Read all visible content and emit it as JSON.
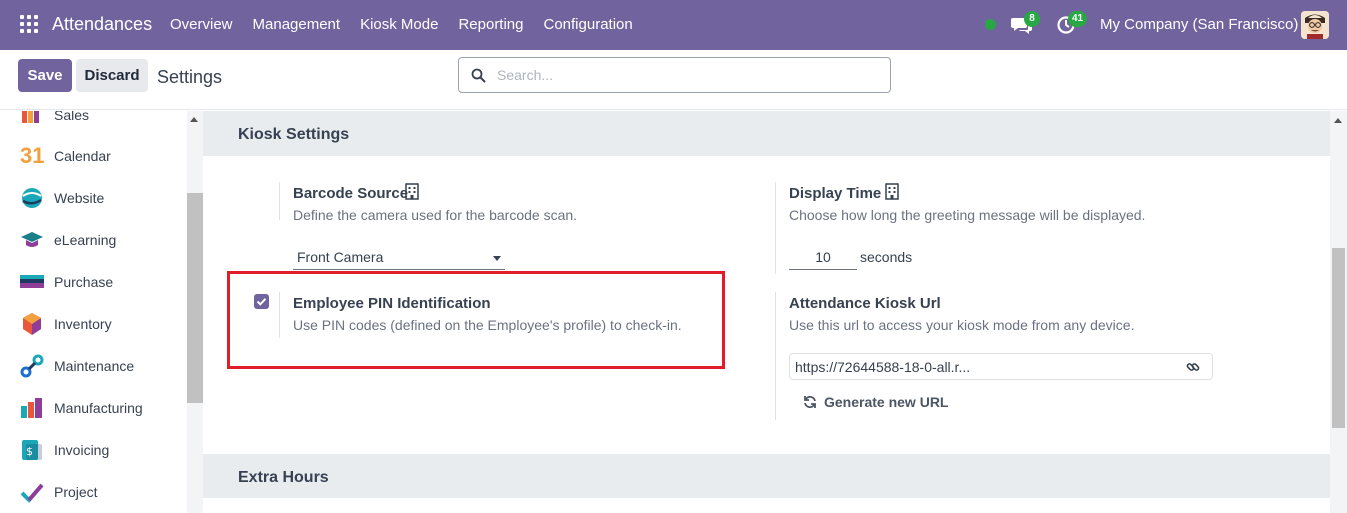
{
  "navbar": {
    "app_title": "Attendances",
    "menu": [
      "Overview",
      "Management",
      "Kiosk Mode",
      "Reporting",
      "Configuration"
    ],
    "chat_badge": "8",
    "activity_badge": "41",
    "company": "My Company (San Francisco)",
    "presence_color": "#28a745",
    "brand_color": "#71639e"
  },
  "control": {
    "save_label": "Save",
    "discard_label": "Discard",
    "title": "Settings",
    "search_placeholder": "Search..."
  },
  "sidebar": {
    "items": [
      {
        "label": "Sales",
        "icon": "sales-icon"
      },
      {
        "label": "Calendar",
        "icon": "calendar-icon"
      },
      {
        "label": "Website",
        "icon": "website-icon"
      },
      {
        "label": "eLearning",
        "icon": "elearning-icon"
      },
      {
        "label": "Purchase",
        "icon": "purchase-icon"
      },
      {
        "label": "Inventory",
        "icon": "inventory-icon"
      },
      {
        "label": "Maintenance",
        "icon": "maintenance-icon"
      },
      {
        "label": "Manufacturing",
        "icon": "manufacturing-icon"
      },
      {
        "label": "Invoicing",
        "icon": "invoicing-icon"
      },
      {
        "label": "Project",
        "icon": "project-icon"
      }
    ],
    "calendar_number": "31"
  },
  "kiosk": {
    "section_title": "Kiosk Settings",
    "barcode": {
      "title": "Barcode Source",
      "desc": "Define the camera used for the barcode scan.",
      "value": "Front Camera"
    },
    "display_time": {
      "title": "Display Time",
      "desc": "Choose how long the greeting message will be displayed.",
      "value": "10",
      "unit": "seconds"
    },
    "pin": {
      "title": "Employee PIN Identification",
      "desc": "Use PIN codes (defined on the Employee's profile) to check-in.",
      "checked": true
    },
    "kiosk_url": {
      "title": "Attendance Kiosk Url",
      "desc": "Use this url to access your kiosk mode from any device.",
      "value": "https://72644588-18-0-all.r...",
      "generate_label": "Generate new URL"
    }
  },
  "extra_hours": {
    "section_title": "Extra Hours"
  },
  "highlight_color": "#e11d2a"
}
